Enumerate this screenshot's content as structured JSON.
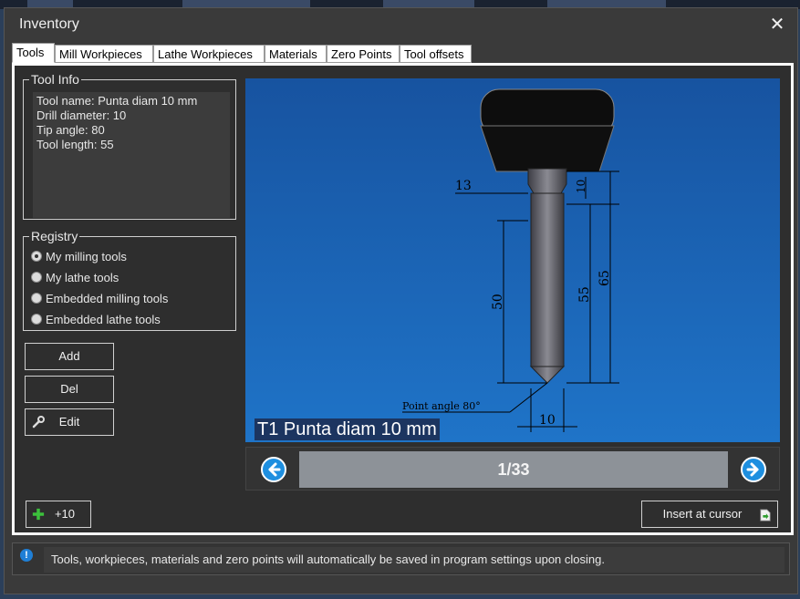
{
  "window": {
    "title": "Inventory",
    "close_symbol": "✕"
  },
  "tabs": [
    {
      "label": "Tools",
      "active": true
    },
    {
      "label": "Mill Workpieces"
    },
    {
      "label": "Lathe Workpieces"
    },
    {
      "label": "Materials"
    },
    {
      "label": "Zero Points"
    },
    {
      "label": "Tool offsets"
    }
  ],
  "tool_info": {
    "legend": "Tool Info",
    "lines": [
      "Tool name: Punta diam 10 mm",
      "Drill diameter: 10",
      "Tip angle: 80",
      "Tool length: 55"
    ]
  },
  "registry": {
    "legend": "Registry",
    "options": [
      {
        "label": "My milling tools",
        "checked": true
      },
      {
        "label": "My lathe tools",
        "checked": false
      },
      {
        "label": "Embedded milling tools",
        "checked": false
      },
      {
        "label": "Embedded lathe tools",
        "checked": false
      }
    ]
  },
  "buttons": {
    "add": "Add",
    "del": "Del",
    "edit": "Edit",
    "plus10": "+10",
    "insert": "Insert at cursor"
  },
  "viewer": {
    "caption": "T1 Punta diam 10 mm",
    "background_color": "#1b66b6",
    "dimensions": {
      "d13": "13",
      "d10_top": "10",
      "d50": "50",
      "d55": "55",
      "d65": "65",
      "d10_bottom": "10",
      "point_angle": "Point angle 80°"
    }
  },
  "pager": {
    "counter": "1/33",
    "prev_icon": "arrow-left-icon",
    "next_icon": "arrow-right-icon"
  },
  "status": {
    "icon": "info-icon",
    "icon_glyph": "!",
    "text": "Tools, workpieces, materials and zero points will automatically be saved in program settings upon closing."
  },
  "colors": {
    "accent": "#1e8fe0",
    "panel": "#2e2e2e",
    "counter_bg": "#8d9298"
  }
}
